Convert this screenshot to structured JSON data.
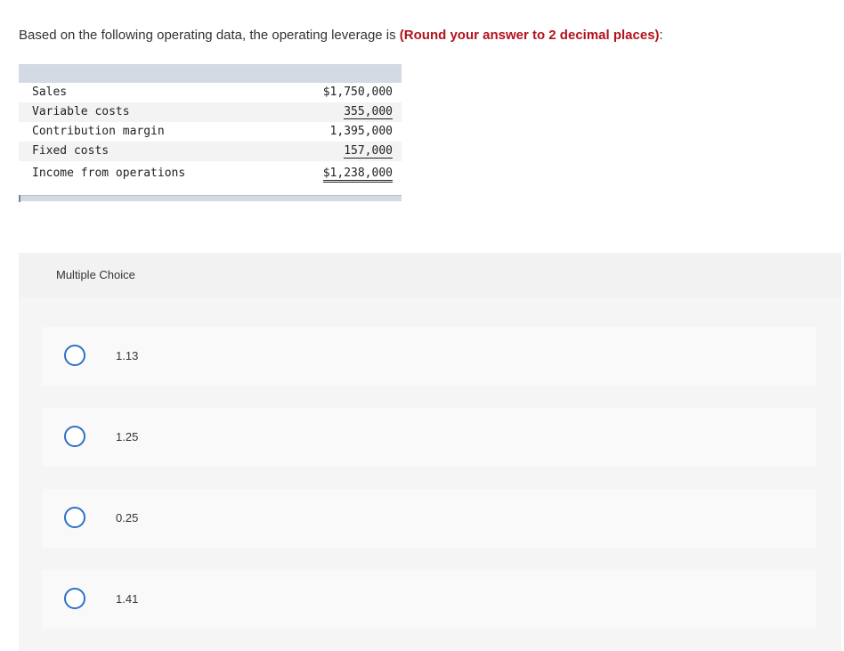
{
  "question": {
    "text": "Based on the following operating data, the operating leverage is ",
    "emphasis": "(Round your answer to 2 decimal places)",
    "suffix": ":"
  },
  "table": {
    "rows": [
      {
        "label": "Sales",
        "amount": "$1,750,000"
      },
      {
        "label": "Variable costs",
        "amount": "355,000"
      },
      {
        "label": "Contribution margin",
        "amount": "1,395,000"
      },
      {
        "label": "Fixed costs",
        "amount": "157,000"
      },
      {
        "label": "Income from operations",
        "amount": "$1,238,000"
      }
    ]
  },
  "multiple_choice": {
    "header": "Multiple Choice",
    "options": [
      {
        "label": "1.13"
      },
      {
        "label": "1.25"
      },
      {
        "label": "0.25"
      },
      {
        "label": "1.41"
      }
    ]
  },
  "colors": {
    "emphasis": "#b3121c",
    "radio_border": "#2f70c5",
    "table_band": "#d3dae3"
  }
}
